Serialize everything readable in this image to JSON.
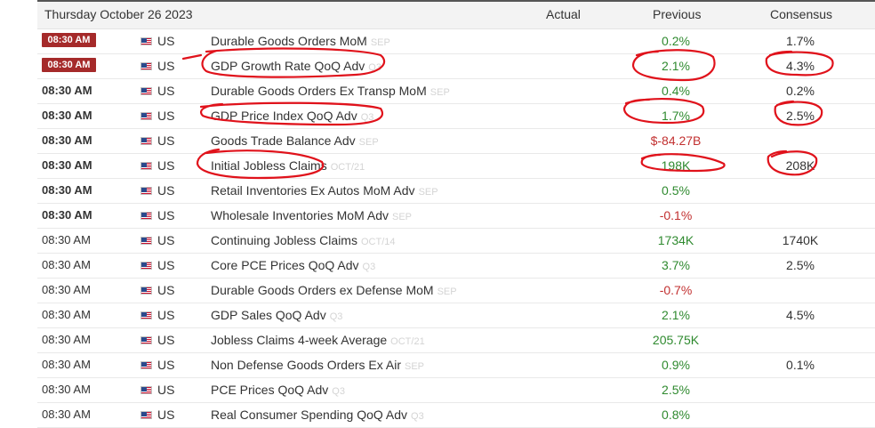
{
  "header": {
    "date": "Thursday October 26 2023",
    "actual_label": "Actual",
    "previous_label": "Previous",
    "consensus_label": "Consensus"
  },
  "colors": {
    "badge": "#a52a2a",
    "positive": "#2f8a2f",
    "negative": "#c23030",
    "annotation": "#e0121b"
  },
  "rows": [
    {
      "time": "08:30 AM",
      "country": "US",
      "event": "Durable Goods Orders MoM",
      "period": "SEP",
      "actual": "",
      "previous": "0.2%",
      "consensus": "1.7%"
    },
    {
      "time": "08:30 AM",
      "country": "US",
      "event": "GDP Growth Rate QoQ Adv",
      "period": "Q3",
      "actual": "",
      "previous": "2.1%",
      "consensus": "4.3%"
    },
    {
      "time": "08:30 AM",
      "country": "US",
      "event": "Durable Goods Orders Ex Transp MoM",
      "period": "SEP",
      "actual": "",
      "previous": "0.4%",
      "consensus": "0.2%"
    },
    {
      "time": "08:30 AM",
      "country": "US",
      "event": "GDP Price Index QoQ Adv",
      "period": "Q3",
      "actual": "",
      "previous": "1.7%",
      "consensus": "2.5%"
    },
    {
      "time": "08:30 AM",
      "country": "US",
      "event": "Goods Trade Balance Adv",
      "period": "SEP",
      "actual": "",
      "previous": "$-84.27B",
      "consensus": ""
    },
    {
      "time": "08:30 AM",
      "country": "US",
      "event": "Initial Jobless Claims",
      "period": "OCT/21",
      "actual": "",
      "previous": "198K",
      "consensus": "208K"
    },
    {
      "time": "08:30 AM",
      "country": "US",
      "event": "Retail Inventories Ex Autos MoM Adv",
      "period": "SEP",
      "actual": "",
      "previous": "0.5%",
      "consensus": ""
    },
    {
      "time": "08:30 AM",
      "country": "US",
      "event": "Wholesale Inventories MoM Adv",
      "period": "SEP",
      "actual": "",
      "previous": "-0.1%",
      "consensus": ""
    },
    {
      "time": "08:30 AM",
      "country": "US",
      "event": "Continuing Jobless Claims",
      "period": "OCT/14",
      "actual": "",
      "previous": "1734K",
      "consensus": "1740K"
    },
    {
      "time": "08:30 AM",
      "country": "US",
      "event": "Core PCE Prices QoQ Adv",
      "period": "Q3",
      "actual": "",
      "previous": "3.7%",
      "consensus": "2.5%"
    },
    {
      "time": "08:30 AM",
      "country": "US",
      "event": "Durable Goods Orders ex Defense MoM",
      "period": "SEP",
      "actual": "",
      "previous": "-0.7%",
      "consensus": ""
    },
    {
      "time": "08:30 AM",
      "country": "US",
      "event": "GDP Sales QoQ Adv",
      "period": "Q3",
      "actual": "",
      "previous": "2.1%",
      "consensus": "4.5%"
    },
    {
      "time": "08:30 AM",
      "country": "US",
      "event": "Jobless Claims 4-week Average",
      "period": "OCT/21",
      "actual": "",
      "previous": "205.75K",
      "consensus": ""
    },
    {
      "time": "08:30 AM",
      "country": "US",
      "event": "Non Defense Goods Orders Ex Air",
      "period": "SEP",
      "actual": "",
      "previous": "0.9%",
      "consensus": "0.1%"
    },
    {
      "time": "08:30 AM",
      "country": "US",
      "event": "PCE Prices QoQ Adv",
      "period": "Q3",
      "actual": "",
      "previous": "2.5%",
      "consensus": ""
    },
    {
      "time": "08:30 AM",
      "country": "US",
      "event": "Real Consumer Spending QoQ Adv",
      "period": "Q3",
      "actual": "",
      "previous": "0.8%",
      "consensus": ""
    }
  ]
}
